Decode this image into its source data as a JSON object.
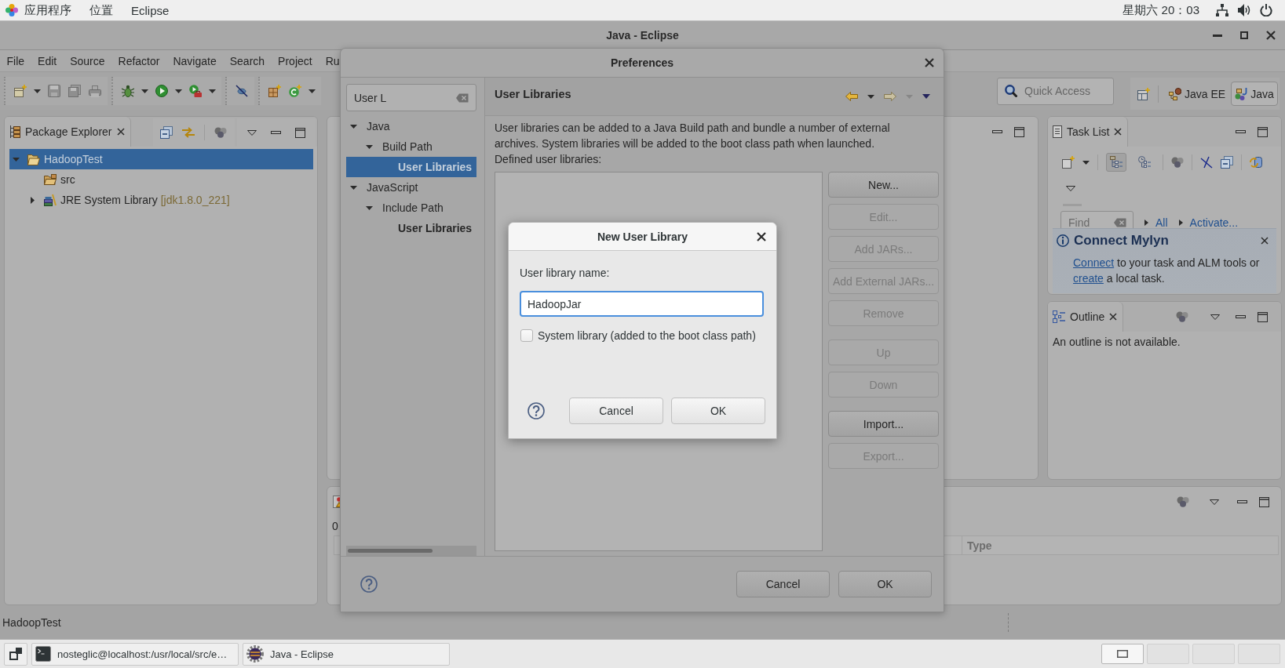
{
  "top_bar": {
    "menus": [
      "应用程序",
      "位置",
      "Eclipse"
    ],
    "clock": "星期六 20：03"
  },
  "window": {
    "title": "Java - Eclipse"
  },
  "menu_bar": [
    "File",
    "Edit",
    "Source",
    "Refactor",
    "Navigate",
    "Search",
    "Project",
    "Ru"
  ],
  "toolbar": {
    "quick_access": {
      "placeholder": "Quick Access"
    },
    "perspectives": [
      {
        "label": "Java EE",
        "selected": false
      },
      {
        "label": "Java",
        "selected": true
      }
    ]
  },
  "package_explorer": {
    "title": "Package Explorer",
    "tree": [
      {
        "label": "HadoopTest",
        "kind": "project",
        "selected": true,
        "expanded": true,
        "children": [
          {
            "label": "src",
            "kind": "source-folder",
            "selected": false
          },
          {
            "label": "JRE System Library",
            "detail": "[jdk1.8.0_221]",
            "kind": "library",
            "selected": false,
            "expanded": false
          }
        ]
      }
    ]
  },
  "task_list": {
    "title": "Task List",
    "modes": [
      {
        "kind": "categorized",
        "selected": true
      },
      {
        "kind": "scheduled",
        "selected": false
      }
    ],
    "find": {
      "placeholder": "Find"
    },
    "links": [
      "All",
      "Activate..."
    ],
    "notice": {
      "title": "Connect Mylyn",
      "message": [
        {
          "kind": "link",
          "text": "Connect"
        },
        {
          "kind": "text",
          "text": " to your task and ALM tools or "
        },
        {
          "kind": "link",
          "text": "create"
        },
        {
          "kind": "text",
          "text": " a local task."
        }
      ]
    }
  },
  "outline": {
    "title": "Outline",
    "message": "An outline is not available."
  },
  "bottom_panel": {
    "summary": "0",
    "columns": [
      "Type"
    ]
  },
  "status_bar": {
    "text": "HadoopTest"
  },
  "preferences": {
    "title": "Preferences",
    "filter": {
      "value": "User L"
    },
    "tree": [
      {
        "label": "Java",
        "selected": false,
        "matched": false,
        "expanded": true,
        "children": [
          {
            "label": "Build Path",
            "selected": false,
            "matched": false,
            "expanded": true,
            "children": [
              {
                "label": "User Libraries",
                "selected": true,
                "matched": true
              }
            ]
          }
        ]
      },
      {
        "label": "JavaScript",
        "selected": false,
        "matched": false,
        "expanded": true,
        "children": [
          {
            "label": "Include Path",
            "selected": false,
            "matched": false,
            "expanded": true,
            "children": [
              {
                "label": "User Libraries",
                "selected": false,
                "matched": true
              }
            ]
          }
        ]
      }
    ],
    "page": {
      "title": "User Libraries",
      "description": "User libraries can be added to a Java Build path and bundle a number of external archives. System libraries will be added to the boot class path when launched.",
      "list_label": "Defined user libraries:",
      "button_groups": [
        [
          {
            "label": "New...",
            "disabled": false
          },
          {
            "label": "Edit...",
            "disabled": true
          },
          {
            "label": "Add JARs...",
            "disabled": true
          },
          {
            "label": "Add External JARs...",
            "disabled": true
          },
          {
            "label": "Remove",
            "disabled": true
          }
        ],
        [
          {
            "label": "Up",
            "disabled": true
          },
          {
            "label": "Down",
            "disabled": true
          }
        ],
        [
          {
            "label": "Import...",
            "disabled": false
          },
          {
            "label": "Export...",
            "disabled": true
          }
        ]
      ]
    },
    "buttons": [
      "Cancel",
      "OK"
    ]
  },
  "new_user_library": {
    "title": "New User Library",
    "name_label": "User library name:",
    "name": {
      "value": "HadoopJar"
    },
    "system_library": {
      "label": "System library (added to the boot class path)",
      "checked": false
    },
    "buttons": [
      "Cancel",
      "OK"
    ]
  },
  "taskbar": {
    "tasks": [
      {
        "label": "nosteglic@localhost:/usr/local/src/e…",
        "kind": "terminal"
      },
      {
        "label": "Java - Eclipse",
        "kind": "eclipse"
      }
    ],
    "workspaces": [
      {
        "selected": true
      },
      {
        "selected": false
      },
      {
        "selected": false
      },
      {
        "selected": false
      }
    ]
  }
}
